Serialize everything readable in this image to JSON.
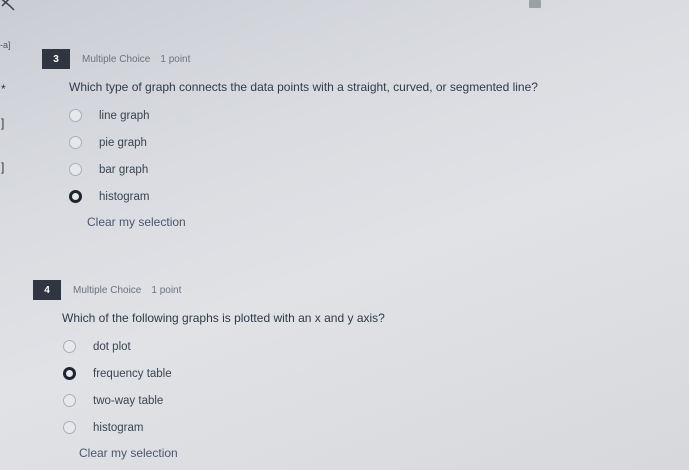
{
  "questions": [
    {
      "number": "3",
      "type": "Multiple Choice",
      "points": "1 point",
      "text": "Which type of graph connects the data points with a straight, curved, or segmented line?",
      "options": [
        {
          "label": "line graph",
          "selected": false
        },
        {
          "label": "pie graph",
          "selected": false
        },
        {
          "label": "bar graph",
          "selected": false
        },
        {
          "label": "histogram",
          "selected": true
        }
      ],
      "clear_label": "Clear my selection"
    },
    {
      "number": "4",
      "type": "Multiple Choice",
      "points": "1 point",
      "text": "Which of the following graphs is plotted with an x and y axis?",
      "options": [
        {
          "label": "dot plot",
          "selected": false
        },
        {
          "label": "frequency table",
          "selected": true
        },
        {
          "label": "two-way table",
          "selected": false
        },
        {
          "label": "histogram",
          "selected": false
        }
      ],
      "clear_label": "Clear my selection"
    }
  ],
  "edge_marks": [
    "-a]",
    "*",
    "]",
    "]"
  ]
}
